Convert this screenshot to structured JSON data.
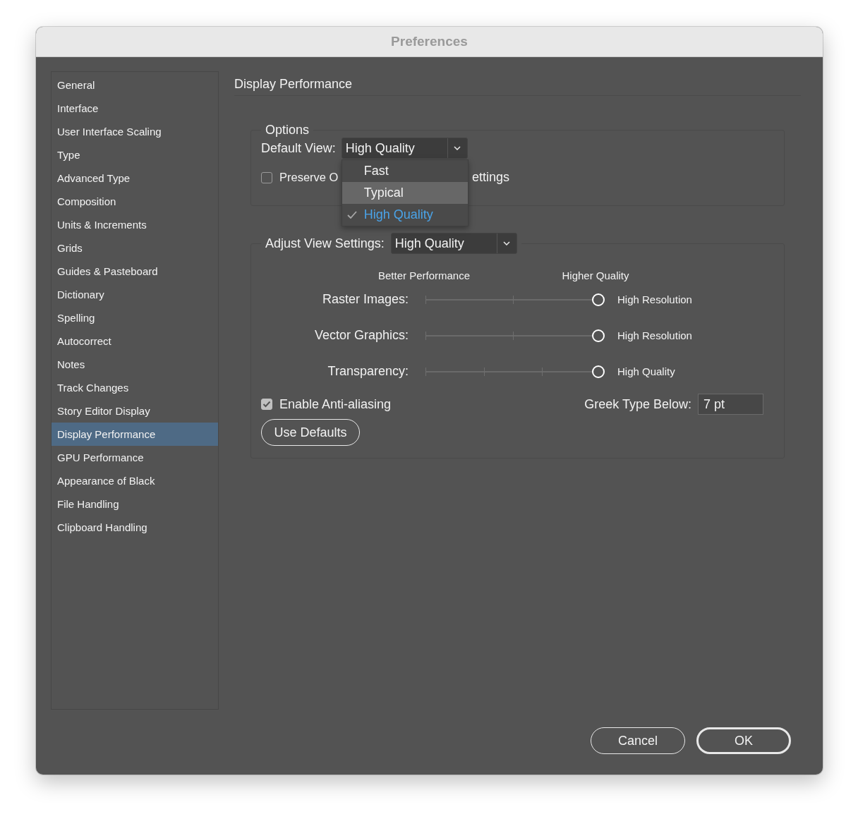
{
  "window": {
    "title": "Preferences"
  },
  "sidebar": {
    "items": [
      {
        "label": "General",
        "selected": false
      },
      {
        "label": "Interface",
        "selected": false
      },
      {
        "label": "User Interface Scaling",
        "selected": false
      },
      {
        "label": "Type",
        "selected": false
      },
      {
        "label": "Advanced Type",
        "selected": false
      },
      {
        "label": "Composition",
        "selected": false
      },
      {
        "label": "Units & Increments",
        "selected": false
      },
      {
        "label": "Grids",
        "selected": false
      },
      {
        "label": "Guides & Pasteboard",
        "selected": false
      },
      {
        "label": "Dictionary",
        "selected": false
      },
      {
        "label": "Spelling",
        "selected": false
      },
      {
        "label": "Autocorrect",
        "selected": false
      },
      {
        "label": "Notes",
        "selected": false
      },
      {
        "label": "Track Changes",
        "selected": false
      },
      {
        "label": "Story Editor Display",
        "selected": false
      },
      {
        "label": "Display Performance",
        "selected": true
      },
      {
        "label": "GPU Performance",
        "selected": false
      },
      {
        "label": "Appearance of Black",
        "selected": false
      },
      {
        "label": "File Handling",
        "selected": false
      },
      {
        "label": "Clipboard Handling",
        "selected": false
      }
    ]
  },
  "page_title": "Display Performance",
  "options": {
    "legend": "Options",
    "default_view": {
      "label": "Default View:",
      "value": "High Quality",
      "menu": [
        {
          "label": "Fast",
          "selected": false,
          "highlighted": false
        },
        {
          "label": "Typical",
          "selected": false,
          "highlighted": true
        },
        {
          "label": "High Quality",
          "selected": true,
          "highlighted": false
        }
      ]
    },
    "preserve": {
      "label_start": "Preserve O",
      "label_end": "ettings",
      "checked": false
    }
  },
  "adjust": {
    "label": "Adjust View Settings:",
    "value": "High Quality",
    "scale_left": "Better Performance",
    "scale_right": "Higher Quality",
    "sliders": [
      {
        "kind": "three-stop",
        "label": "Raster Images:",
        "level": 1,
        "reading": "High Resolution"
      },
      {
        "kind": "three-stop",
        "label": "Vector Graphics:",
        "level": 1,
        "reading": "High Resolution"
      },
      {
        "kind": "four-stop",
        "label": "Transparency:",
        "level": 1,
        "reading": "High Quality"
      }
    ],
    "anti_aliasing": {
      "label": "Enable Anti-aliasing",
      "checked": true
    },
    "greek": {
      "label": "Greek Type Below:",
      "value": "7 pt"
    },
    "use_defaults": "Use Defaults"
  },
  "buttons": [
    {
      "label": "Cancel",
      "default": false
    },
    {
      "label": "OK",
      "default": true
    }
  ]
}
